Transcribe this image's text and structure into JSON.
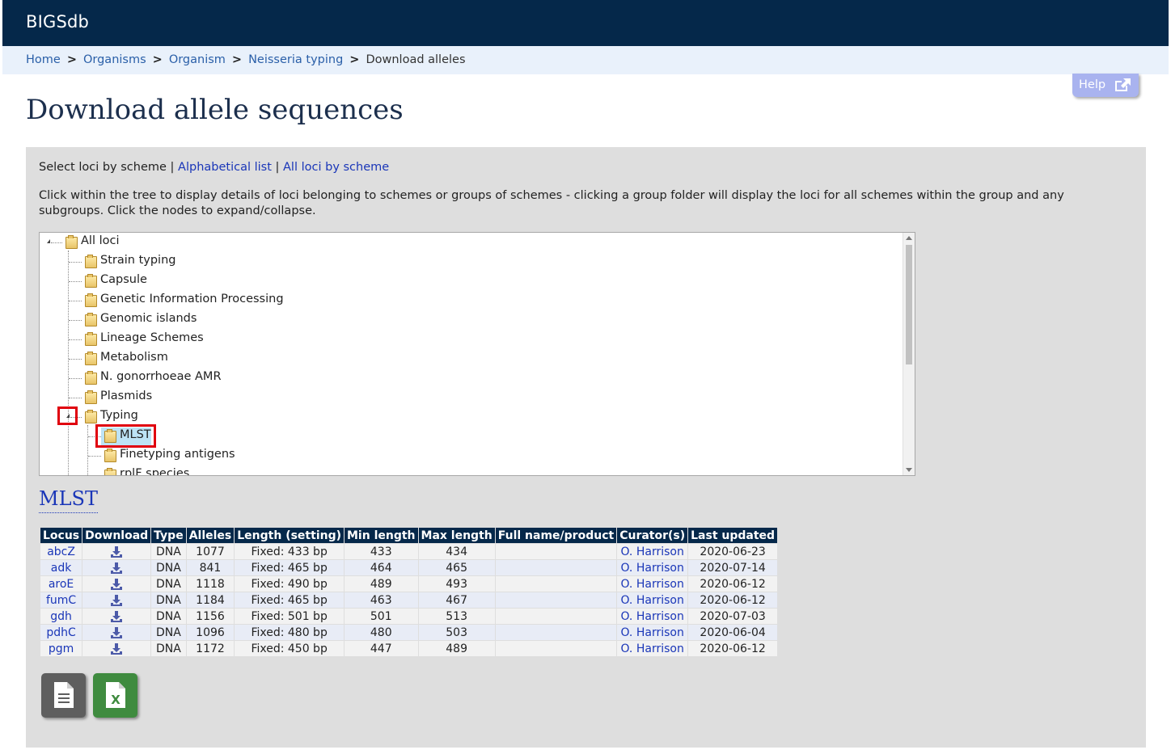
{
  "app": {
    "brand": "BIGSdb"
  },
  "breadcrumb": {
    "home": "Home",
    "organisms": "Organisms",
    "organism": "Organism",
    "db": "Neisseria typing",
    "current": "Download alleles",
    "separator": ">"
  },
  "help": {
    "label": "Help"
  },
  "page": {
    "title": "Download allele sequences"
  },
  "modes": {
    "current": "Select loci by scheme",
    "separator": "|",
    "alpha": "Alphabetical list",
    "all": "All loci by scheme"
  },
  "info": "Click within the tree to display details of loci belonging to schemes or groups of schemes - clicking a group folder will display the loci for all schemes within the group and any subgroups. Click the nodes to expand/collapse.",
  "tree": {
    "root": "All loci",
    "groups": [
      "Strain typing",
      "Capsule",
      "Genetic Information Processing",
      "Genomic islands",
      "Lineage Schemes",
      "Metabolism",
      "N. gonorrhoeae AMR",
      "Plasmids",
      "Typing"
    ],
    "typing_children": [
      "MLST",
      "Finetyping antigens",
      "rplF species"
    ]
  },
  "scheme": {
    "title": "MLST",
    "columns": [
      "Locus",
      "Download",
      "Type",
      "Alleles",
      "Length (setting)",
      "Min length",
      "Max length",
      "Full name/product",
      "Curator(s)",
      "Last updated"
    ],
    "rows": [
      {
        "locus": "abcZ",
        "type": "DNA",
        "alleles": "1077",
        "length": "Fixed: 433 bp",
        "min": "433",
        "max": "434",
        "product": "",
        "curator": "O. Harrison",
        "updated": "2020-06-23"
      },
      {
        "locus": "adk",
        "type": "DNA",
        "alleles": "841",
        "length": "Fixed: 465 bp",
        "min": "464",
        "max": "465",
        "product": "",
        "curator": "O. Harrison",
        "updated": "2020-07-14"
      },
      {
        "locus": "aroE",
        "type": "DNA",
        "alleles": "1118",
        "length": "Fixed: 490 bp",
        "min": "489",
        "max": "493",
        "product": "",
        "curator": "O. Harrison",
        "updated": "2020-06-12"
      },
      {
        "locus": "fumC",
        "type": "DNA",
        "alleles": "1184",
        "length": "Fixed: 465 bp",
        "min": "463",
        "max": "467",
        "product": "",
        "curator": "O. Harrison",
        "updated": "2020-06-12"
      },
      {
        "locus": "gdh",
        "type": "DNA",
        "alleles": "1156",
        "length": "Fixed: 501 bp",
        "min": "501",
        "max": "513",
        "product": "",
        "curator": "O. Harrison",
        "updated": "2020-07-03"
      },
      {
        "locus": "pdhC",
        "type": "DNA",
        "alleles": "1096",
        "length": "Fixed: 480 bp",
        "min": "480",
        "max": "503",
        "product": "",
        "curator": "O. Harrison",
        "updated": "2020-06-04"
      },
      {
        "locus": "pgm",
        "type": "DNA",
        "alleles": "1172",
        "length": "Fixed: 450 bp",
        "min": "447",
        "max": "489",
        "product": "",
        "curator": "O. Harrison",
        "updated": "2020-06-12"
      }
    ]
  },
  "export": {
    "text_icon": "text-file-icon",
    "excel_icon": "excel-file-icon",
    "excel_letter": "X"
  },
  "colors": {
    "topbar": "#05284a",
    "breadcrumb_bg": "#e9f1fb",
    "help_btn": "#a9b3ef",
    "panel": "#dedede",
    "link": "#1a36b8",
    "highlight": "#e0000e",
    "excel": "#3f8b3f",
    "text_btn": "#5e5e5e"
  }
}
